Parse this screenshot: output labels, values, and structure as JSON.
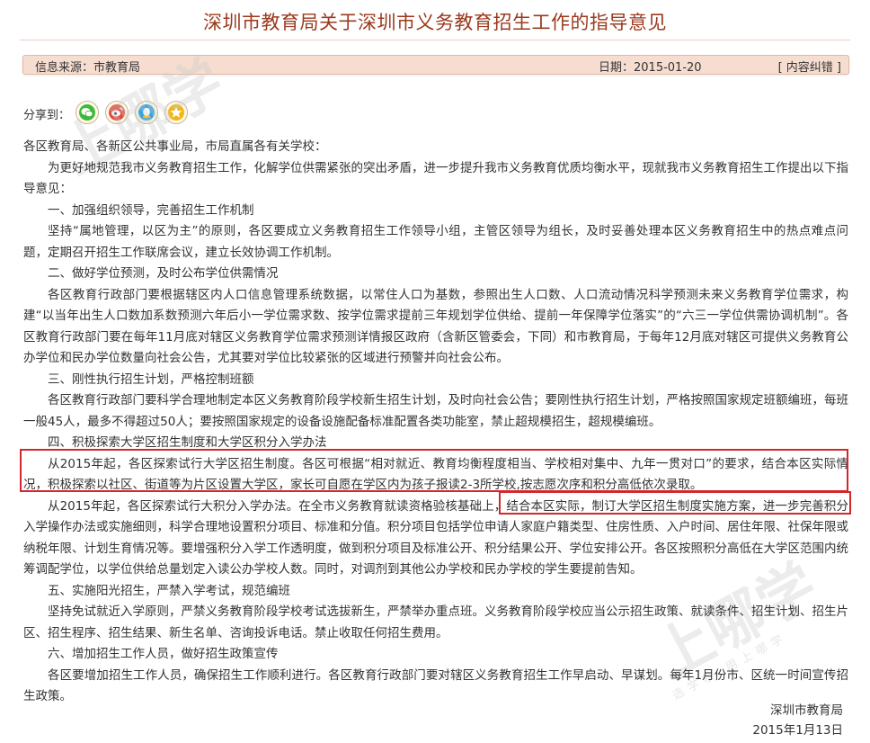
{
  "header": {
    "title": "深圳市教育局关于深圳市义务教育招生工作的指导意见"
  },
  "info_bar": {
    "source": "信息来源：市教育局",
    "date": "日期：2015-01-20",
    "correction": "[ 内容纠错 ]"
  },
  "share": {
    "label": "分享到：",
    "icons": [
      "wechat-icon",
      "weibo-icon",
      "qq-icon",
      "qzone-star-icon"
    ]
  },
  "watermark": {
    "text": "上哪学",
    "tagline": "选学校 用上哪学"
  },
  "colors": {
    "title": "#9b3a1e",
    "info_bar_bg": "#f6ddd0",
    "highlight_border": "#d4262b"
  },
  "document": {
    "salutation": "各区教育局、各新区公共事业局，市局直属各有关学校：",
    "intro": "为更好地规范我市义务教育招生工作，化解学位供需紧张的突出矛盾，进一步提升我市义务教育优质均衡水平，现就我市义务教育招生工作提出以下指导意见：",
    "sections": [
      {
        "heading": "一、加强组织领导，完善招生工作机制",
        "paragraphs": [
          "坚持“属地管理，以区为主”的原则，各区要成立义务教育招生工作领导小组，主管区领导为组长，及时妥善处理本区义务教育招生中的热点难点问题，定期召开招生工作联席会议，建立长效协调工作机制。"
        ]
      },
      {
        "heading": "二、做好学位预测，及时公布学位供需情况",
        "paragraphs": [
          "各区教育行政部门要根据辖区内人口信息管理系统数据，以常住人口为基数，参照出生人口数、人口流动情况科学预测未来义务教育学位需求，构建“以当年出生人口数加系数预测六年后小一学位需求数、按学位需求提前三年规划学位供给、提前一年保障学位落实”的“六三一学位供需协调机制”。各区教育行政部门要在每年11月底对辖区义务教育学位需求预测详情报区政府（含新区管委会，下同）和市教育局，于每年12月底对辖区可提供义务教育公办学位和民办学位数量向社会公告，尤其要对学位比较紧张的区域进行预警并向社会公布。"
        ]
      },
      {
        "heading": "三、刚性执行招生计划，严格控制班额",
        "paragraphs": [
          "各区教育行政部门要科学合理地制定本区义务教育阶段学校新生招生计划，及时向社会公告；要刚性执行招生计划，严格按照国家规定班额编班，每班一般45人，最多不得超过50人；要按照国家规定的设备设施配备标准配置各类功能室，禁止超规模招生，超规模编班。"
        ]
      },
      {
        "heading": "四、积极探索大学区招生制度和大学区积分入学办法",
        "paragraphs": [
          "从2015年起，各区探索试行大学区招生制度。各区可根据“相对就近、教育均衡程度相当、学校相对集中、九年一贯对口”的要求，结合本区实际情况，积极探索以社区、街道等为片区设置大学区，家长可自愿在学区内为孩子报读2-3所学校,按志愿次序和积分高低依次录取。",
          "从2015年起，各区探索试行大积分入学办法。在全市义务教育就读资格验核基础上，结合本区实际，制订大学区招生制度实施方案，进一步完善积分入学操作办法或实施细则，科学合理地设置积分项目、标准和分值。积分项目包括学位申请人家庭户籍类型、住房性质、入户时间、居住年限、社保年限或纳税年限、计划生育情况等。要增强积分入学工作透明度，做到积分项目及标准公开、积分结果公开、学位安排公开。各区按照积分高低在大学区范围内统筹调配学位，以学位供给总量划定入读公办学校人数。同时，对调剂到其他公办学校和民办学校的学生要提前告知。"
        ]
      },
      {
        "heading": "五、实施阳光招生，严禁入学考试，规范编班",
        "paragraphs": [
          "坚持免试就近入学原则，严禁义务教育阶段学校考试选拔新生，严禁举办重点班。义务教育阶段学校应当公示招生政策、就读条件、招生计划、招生片区、招生程序、招生结果、新生名单、咨询投诉电话。禁止收取任何招生费用。"
        ]
      },
      {
        "heading": "六、增加招生工作人员，做好招生政策宣传",
        "paragraphs": [
          "各区要增加招生工作人员，确保招生工作顺利进行。各区教育行政部门要对辖区义务教育招生工作早启动、早谋划。每年1月份市、区统一时间宣传招生政策。"
        ]
      }
    ],
    "signature": "深圳市教育局",
    "sign_date": "2015年1月13日"
  }
}
